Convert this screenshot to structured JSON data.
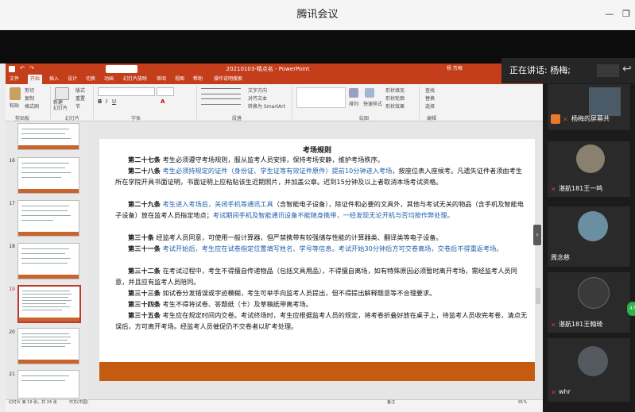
{
  "window": {
    "title": "腾讯会议"
  },
  "powerpoint": {
    "title": "20210103-精点名 - PowerPoint",
    "user": "杨 芳梅",
    "tabs": [
      "文件",
      "开始",
      "插入",
      "设计",
      "切换",
      "动画",
      "幻灯片放映",
      "审阅",
      "视图",
      "帮助",
      "操作说明搜索"
    ],
    "active_tab": "开始",
    "ribbon": {
      "paste": "粘贴",
      "cut": "剪切",
      "copy": "复制",
      "format_painter": "格式刷",
      "new_slide": "新建\n幻灯片",
      "layout": "版式",
      "reset": "重置",
      "section": "节",
      "group_clipboard": "剪贴板",
      "group_slides": "幻灯片",
      "group_font": "字体",
      "group_paragraph": "段落",
      "group_drawing": "绘图",
      "group_editing": "编辑",
      "text_direction": "文字方向",
      "align_text": "对齐文本",
      "smartart": "转换为 SmartArt",
      "arrange": "排列",
      "quick_styles": "快速样式",
      "shape_fill": "形状填充",
      "shape_outline": "形状轮廓",
      "shape_effects": "形状效果",
      "find": "查找",
      "replace": "替换",
      "select": "选择"
    },
    "thumbnails": [
      {
        "num": ""
      },
      {
        "num": "16"
      },
      {
        "num": "17"
      },
      {
        "num": "18"
      },
      {
        "num": "19"
      },
      {
        "num": "20"
      },
      {
        "num": "21"
      }
    ],
    "status": {
      "slide_info": "幻灯片 第 19 张，共 24 张",
      "lang": "中文(中国)",
      "notes": "备注",
      "zoom": "91%"
    }
  },
  "slide": {
    "title": "考场规则",
    "p27_label": "第二十七条",
    "p27_text": "考生必须遵守考场规则，服从监考人员安排，保持考场安静，维护考场秩序。",
    "p28_label": "第二十八条",
    "p28_hl": "考生必须持规定的证件（身份证、学生证等有效证件原件）提前10分钟进入考场",
    "p28_text": "，按座位表入座候考。凡遗失证件者须由考生所在学院开具书面证明，书面证明上应粘贴该生近期照片，并加盖公章。迟到15分钟及以上者取消本场考试资格。",
    "p29_label": "第二十九条",
    "p29_hl1": "考生进入考场后，关闭手机等通讯工具",
    "p29_text1": "（含智能电子设备），除证件和必要的文具外，其他与考试无关的物品（含手机及智能电子设备）放在监考人员指定地点；",
    "p29_hl2": "考试期间手机及智能通讯设备不能随身携带，一经发现无论开机与否均按作弊处理。",
    "p30_label": "第三十条",
    "p30_text": "经监考人员同意，可使用一般计算器，但严禁携带有较强储存性能的计算器类、翻译类等电子设备。",
    "p31_label": "第三十一条",
    "p31_hl": "考试开始后，考生应在试卷指定位置填写姓名、学号等信息。考试开始30分钟后方可交卷离场，交卷后不得重返考场。",
    "p32_label": "第三十二条",
    "p32_text": "在考试过程中，考生不得擅自传递物品（包括文具用品），不得擅自离场，如有特殊原因必须暂时离开考场，需经监考人员同意，并且应有监考人员陪同。",
    "p33_label": "第三十三条",
    "p33_text": "如试卷分发错误或字迹模糊，考生可举手向监考人员提出，但不得提出解释题意等不合理要求。",
    "p34_label": "第三十四条",
    "p34_text": "考生不得将试卷、答题纸（卡）及草稿纸带离考场。",
    "p35_label": "第三十五条",
    "p35_text": "考生应在规定时间内交卷。考试终场时，考生应根据监考人员的规定，将考卷折叠好放在桌子上，待监考人员收完考卷，清点无误后，方可离开考场。经监考人员催促仍不交卷者以旷考处理。"
  },
  "meeting": {
    "speaking": "正在讲话: 杨梅;",
    "participants": [
      {
        "name": "杨梅的屏幕共",
        "color": "#5a6a72"
      },
      {
        "name": "湛航181王一鸣",
        "color": "#8a8070"
      },
      {
        "name": "周念慈",
        "color": "#6a8fa0"
      },
      {
        "name": "湛航181王翰琦",
        "color": "#3a3a3a"
      },
      {
        "name": "whr",
        "color": "#555a60"
      }
    ],
    "badge": "47"
  }
}
